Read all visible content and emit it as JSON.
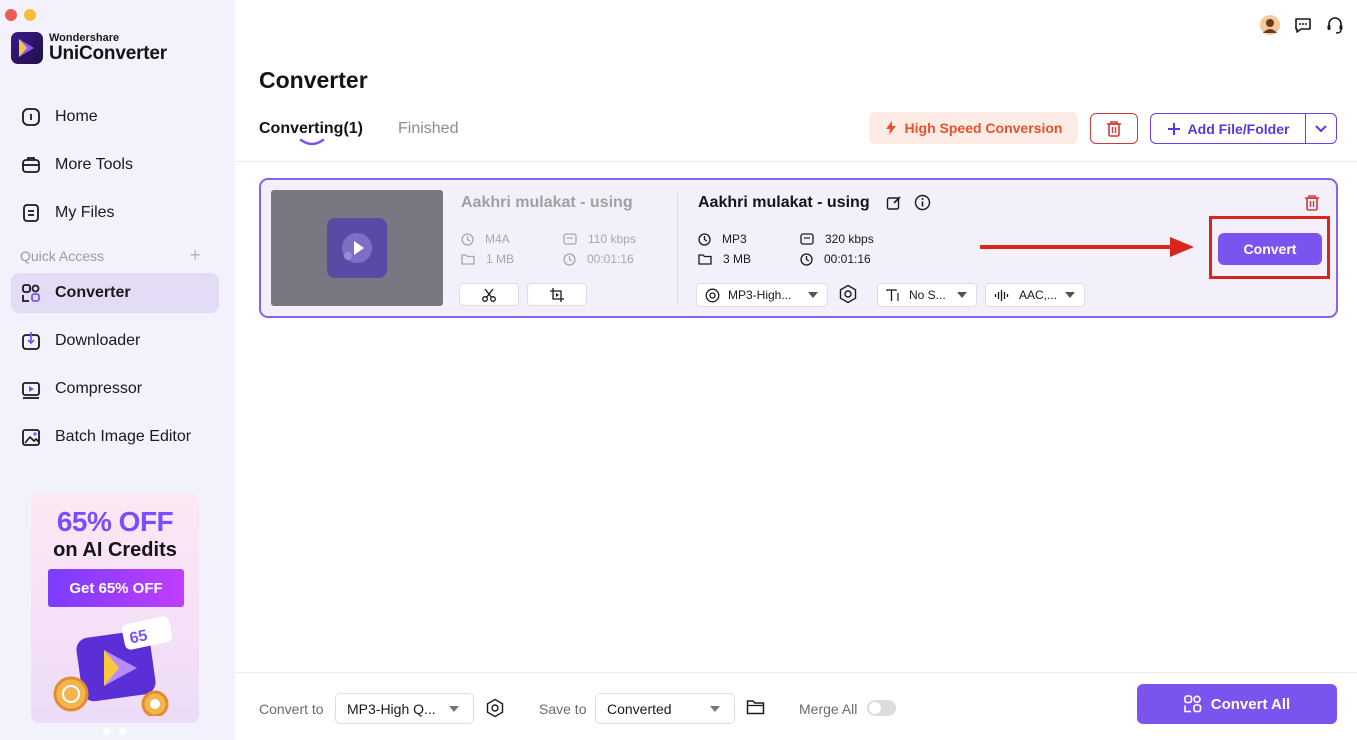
{
  "app": {
    "brand_small": "Wondershare",
    "brand_name": "UniConverter"
  },
  "sidebar": {
    "items": [
      {
        "label": "Home",
        "icon": "home-icon"
      },
      {
        "label": "More Tools",
        "icon": "toolbox-icon"
      },
      {
        "label": "My Files",
        "icon": "file-icon"
      }
    ],
    "quick_access_label": "Quick Access",
    "quick_access_add": "+",
    "quick_items": [
      {
        "label": "Converter",
        "icon": "converter-icon",
        "active": true
      },
      {
        "label": "Downloader",
        "icon": "downloader-icon"
      },
      {
        "label": "Compressor",
        "icon": "compressor-icon"
      },
      {
        "label": "Batch Image Editor",
        "icon": "image-editor-icon"
      }
    ],
    "promo": {
      "headline": "65% OFF",
      "subline": "on AI Credits",
      "button": "Get 65% OFF",
      "sticker": "65"
    }
  },
  "header": {
    "title": "Converter",
    "tabs": [
      {
        "label": "Converting(1)",
        "active": true
      },
      {
        "label": "Finished",
        "active": false
      }
    ],
    "high_speed_label": "High Speed Conversion",
    "add_file_label": "Add File/Folder"
  },
  "file": {
    "source": {
      "name": "Aakhri mulakat - using",
      "format": "M4A",
      "bitrate": "110 kbps",
      "size": "1 MB",
      "duration": "00:01:16"
    },
    "target": {
      "name": "Aakhri mulakat - using",
      "format": "MP3",
      "bitrate": "320 kbps",
      "size": "3 MB",
      "duration": "00:01:16",
      "preset": "MP3-High...",
      "subtitle": "No S...",
      "audio": "AAC,..."
    },
    "convert_label": "Convert"
  },
  "bottom": {
    "convert_to_label": "Convert to",
    "convert_to_value": "MP3-High Q...",
    "save_to_label": "Save to",
    "save_to_value": "Converted",
    "merge_label": "Merge All",
    "merge_on": false,
    "convert_all_label": "Convert All"
  },
  "colors": {
    "accent": "#7b54f0",
    "sidebar_bg": "#f3f1fb",
    "danger": "#d03a3a",
    "high_speed": "#e5532b",
    "annotation": "#d9261c"
  }
}
